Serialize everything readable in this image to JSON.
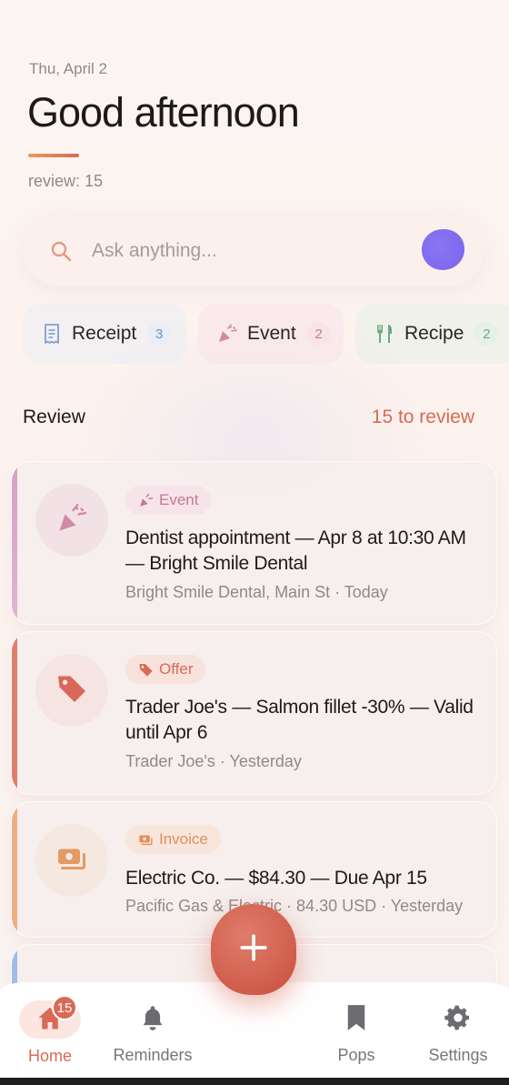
{
  "header": {
    "date": "Thu, April 2",
    "greeting": "Good afternoon",
    "review_count": "review: 15"
  },
  "search": {
    "placeholder": "Ask anything..."
  },
  "chips": [
    {
      "label": "Receipt",
      "count": "3",
      "icon": "receipt-icon"
    },
    {
      "label": "Event",
      "count": "2",
      "icon": "party-popper-icon"
    },
    {
      "label": "Recipe",
      "count": "2",
      "icon": "fork-knife-icon"
    }
  ],
  "review": {
    "title": "Review",
    "link": "15 to review"
  },
  "cards": [
    {
      "tag": "Event",
      "icon": "party-popper-icon",
      "title": "Dentist appointment — Apr 8 at 10:30 AM — Bright Smile Dental",
      "meta": "Bright Smile Dental, Main St · Today"
    },
    {
      "tag": "Offer",
      "icon": "price-tag-icon",
      "title": "Trader Joe's — Salmon fillet -30% — Valid until Apr 6",
      "meta": "Trader Joe's · Yesterday"
    },
    {
      "tag": "Invoice",
      "icon": "money-bill-icon",
      "title": "Electric Co. — $84.30 — Due Apr 15",
      "meta": "Pacific Gas & Electric · 84.30 USD · Yesterday"
    }
  ],
  "nav": {
    "home": "Home",
    "home_badge": "15",
    "reminders": "Reminders",
    "pops": "Pops",
    "settings": "Settings"
  },
  "colors": {
    "accent": "#d96a57",
    "orb": "#7a63ee",
    "event": "#c27a95",
    "invoice": "#e09058",
    "receipt": "#6e8fc8",
    "recipe": "#6aab7c"
  }
}
